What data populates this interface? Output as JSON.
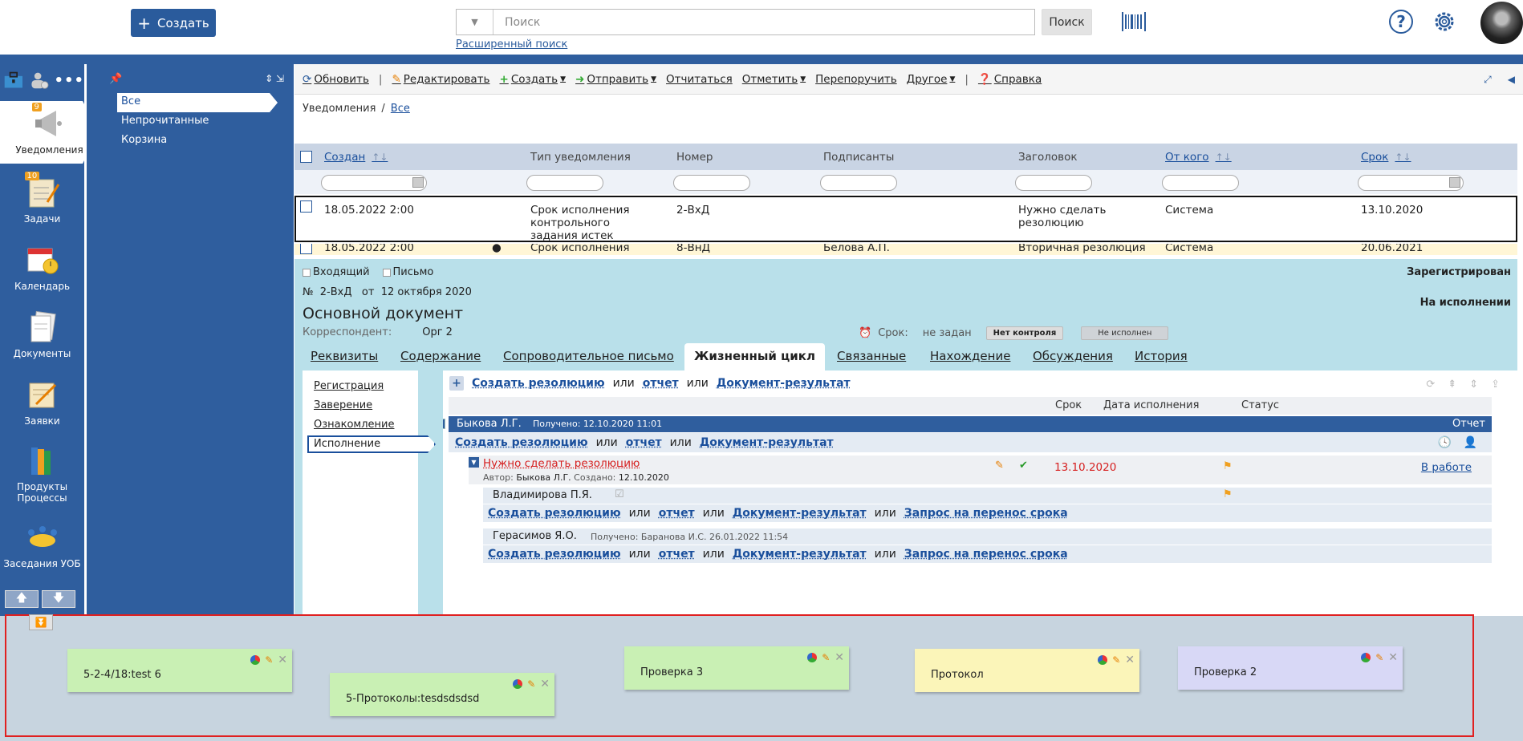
{
  "header": {
    "create_label": "Создать",
    "search_placeholder": "Поиск",
    "search_button": "Поиск",
    "advanced_search": "Расширенный поиск"
  },
  "rail": {
    "items": [
      {
        "label": "Уведомления",
        "badge": "9"
      },
      {
        "label": "Задачи",
        "badge": "10"
      },
      {
        "label": "Календарь"
      },
      {
        "label": "Документы"
      },
      {
        "label": "Заявки"
      },
      {
        "label": "Продукты Процессы"
      },
      {
        "label": "Заседания УОБ"
      }
    ]
  },
  "folders": [
    "Все",
    "Непрочитанные",
    "Корзина"
  ],
  "toolbar": {
    "refresh": "Обновить",
    "edit": "Редактировать",
    "create": "Создать",
    "send": "Отправить",
    "report": "Отчитаться",
    "mark": "Отметить",
    "reassign": "Перепоручить",
    "other": "Другое",
    "help": "Справка"
  },
  "breadcrumb": {
    "root": "Уведомления",
    "current": "Все"
  },
  "grid": {
    "columns": [
      "Создан",
      "Тип уведомления",
      "Номер",
      "Подписанты",
      "Заголовок",
      "От кого",
      "Срок"
    ],
    "rows": [
      {
        "created": "18.05.2022 2:00",
        "type": "Срок исполнения контрольного задания истек",
        "number": "2-ВхД",
        "signers": "",
        "title": "Нужно сделать резолюцию",
        "from": "Система",
        "deadline": "13.10.2020"
      },
      {
        "created": "18.05.2022 2:00",
        "type": "Срок исполнения",
        "number": "8-ВнД",
        "signers": "Белова А.П.",
        "title": "Вторичная резолюция",
        "from": "Система",
        "deadline": "20.06.2021"
      }
    ]
  },
  "document": {
    "tag1": "Входящий",
    "tag2": "Письмо",
    "number_line": "№  2-ВхД   от  12 октября 2020",
    "title": "Основной документ",
    "correspondent_label": "Корреспондент:",
    "correspondent": "Орг 2",
    "deadline_label": "Срок:",
    "deadline_value": "не задан",
    "control": "Нет контроля",
    "exec_state": "Не исполнен",
    "status_registered": "Зарегистрирован",
    "status_execution": "На исполнении",
    "tabs": [
      "Реквизиты",
      "Содержание",
      "Сопроводительное письмо",
      "Жизненный цикл",
      "Связанные",
      "Нахождение",
      "Обсуждения",
      "История"
    ],
    "subnav": [
      "Регистрация",
      "Заверение",
      "Ознакомление",
      "Исполнение"
    ]
  },
  "lifecycle": {
    "create_resolution": "Создать резолюцию",
    "or": "или",
    "report": "отчет",
    "doc_result": "Документ-результат",
    "postpone": "Запрос на перенос срока",
    "col_deadline": "Срок",
    "col_exec_date": "Дата исполнения",
    "col_status": "Статус",
    "person": "Быкова Л.Г.",
    "person_received": "Получено: 12.10.2020 11:01",
    "person_status": "Отчет",
    "resolution_title": "Нужно сделать резолюцию",
    "resolution_author_label": "Автор:",
    "resolution_author": "Быкова Л.Г.",
    "resolution_created_label": "Создано:",
    "resolution_created": "12.10.2020",
    "resolution_deadline": "13.10.2020",
    "resolution_status": "В работе",
    "executor1": "Владимирова П.Я.",
    "executor2": "Герасимов Я.О.",
    "executor2_received": "Получено: Баранова И.С. 26.01.2022 11:54"
  },
  "notes": [
    {
      "text": "5-2-4/18:test 6",
      "color": "#c9f0b4"
    },
    {
      "text": "5-Протоколы:tesdsdsdsd",
      "color": "#c9f0b4"
    },
    {
      "text": "Проверка 3",
      "color": "#c9f0b4"
    },
    {
      "text": "Протокол",
      "color": "#fbf5b9"
    },
    {
      "text": "Проверка 2",
      "color": "#d8d8f6"
    }
  ]
}
